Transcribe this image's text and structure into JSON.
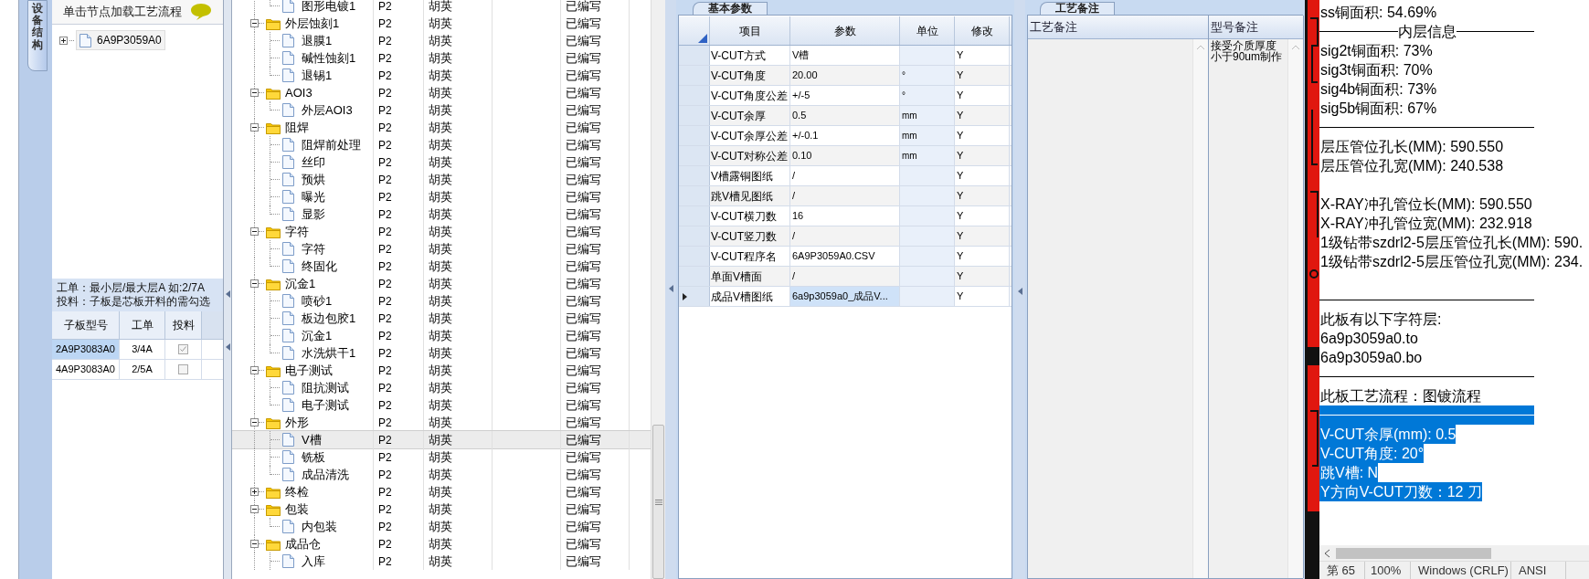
{
  "side_tab": {
    "label": "设备结构"
  },
  "process_panel": {
    "header": "单击节点加载工艺流程",
    "tree": [
      {
        "label": "6A9P3059A0",
        "expanded": false
      }
    ],
    "info": [
      "工单：最小层/最大层A 如:2/7A",
      "投料：子板是芯板开料的需勾选"
    ],
    "columns": [
      "子板型号",
      "工单",
      "投料"
    ],
    "rows": [
      {
        "model": "2A9P3083A0",
        "order": "3/4A",
        "checked": true,
        "selected": true
      },
      {
        "model": "4A9P3083A0",
        "order": "2/5A",
        "checked": false,
        "selected": false
      }
    ]
  },
  "flow_tree": {
    "groups": [
      {
        "children": [
          {
            "name": "图形电镀1",
            "code": "P2",
            "person": "胡英",
            "status": "已编写",
            "selected": false
          }
        ]
      },
      {
        "name": "外层蚀刻1",
        "code": "P2",
        "person": "胡英",
        "status": "已编写",
        "expanded": true,
        "selected": false,
        "children": [
          {
            "name": "退膜1",
            "code": "P2",
            "person": "胡英",
            "status": "已编写",
            "selected": false
          },
          {
            "name": "碱性蚀刻1",
            "code": "P2",
            "person": "胡英",
            "status": "已编写",
            "selected": false
          },
          {
            "name": "退锡1",
            "code": "P2",
            "person": "胡英",
            "status": "已编写",
            "selected": false
          }
        ]
      },
      {
        "name": "AOI3",
        "code": "P2",
        "person": "胡英",
        "status": "已编写",
        "expanded": true,
        "selected": false,
        "children": [
          {
            "name": "外层AOI3",
            "code": "P2",
            "person": "胡英",
            "status": "已编写",
            "selected": false
          }
        ]
      },
      {
        "name": "阻焊",
        "code": "P2",
        "person": "胡英",
        "status": "已编写",
        "expanded": true,
        "selected": false,
        "children": [
          {
            "name": "阻焊前处理",
            "code": "P2",
            "person": "胡英",
            "status": "已编写",
            "selected": false
          },
          {
            "name": "丝印",
            "code": "P2",
            "person": "胡英",
            "status": "已编写",
            "selected": false
          },
          {
            "name": "预烘",
            "code": "P2",
            "person": "胡英",
            "status": "已编写",
            "selected": false
          },
          {
            "name": "曝光",
            "code": "P2",
            "person": "胡英",
            "status": "已编写",
            "selected": false
          },
          {
            "name": "显影",
            "code": "P2",
            "person": "胡英",
            "status": "已编写",
            "selected": false
          }
        ]
      },
      {
        "name": "字符",
        "code": "P2",
        "person": "胡英",
        "status": "已编写",
        "expanded": true,
        "selected": false,
        "children": [
          {
            "name": "字符",
            "code": "P2",
            "person": "胡英",
            "status": "已编写",
            "selected": false
          },
          {
            "name": "终固化",
            "code": "P2",
            "person": "胡英",
            "status": "已编写",
            "selected": false
          }
        ]
      },
      {
        "name": "沉金1",
        "code": "P2",
        "person": "胡英",
        "status": "已编写",
        "expanded": true,
        "selected": false,
        "children": [
          {
            "name": "喷砂1",
            "code": "P2",
            "person": "胡英",
            "status": "已编写",
            "selected": false
          },
          {
            "name": "板边包胶1",
            "code": "P2",
            "person": "胡英",
            "status": "已编写",
            "selected": false
          },
          {
            "name": "沉金1",
            "code": "P2",
            "person": "胡英",
            "status": "已编写",
            "selected": false
          },
          {
            "name": "水洗烘干1",
            "code": "P2",
            "person": "胡英",
            "status": "已编写",
            "selected": false
          }
        ]
      },
      {
        "name": "电子测试",
        "code": "P2",
        "person": "胡英",
        "status": "已编写",
        "expanded": true,
        "selected": false,
        "children": [
          {
            "name": "阻抗测试",
            "code": "P2",
            "person": "胡英",
            "status": "已编写",
            "selected": false
          },
          {
            "name": "电子测试",
            "code": "P2",
            "person": "胡英",
            "status": "已编写",
            "selected": false
          }
        ]
      },
      {
        "name": "外形",
        "code": "P2",
        "person": "胡英",
        "status": "已编写",
        "expanded": true,
        "selected": false,
        "children": [
          {
            "name": "V槽",
            "code": "P2",
            "person": "胡英",
            "status": "已编写",
            "selected": true
          },
          {
            "name": "铣板",
            "code": "P2",
            "person": "胡英",
            "status": "已编写",
            "selected": false
          },
          {
            "name": "成品清洗",
            "code": "P2",
            "person": "胡英",
            "status": "已编写",
            "selected": false
          }
        ]
      },
      {
        "name": "终检",
        "code": "P2",
        "person": "胡英",
        "status": "已编写",
        "expanded": false,
        "selected": false
      },
      {
        "name": "包装",
        "code": "P2",
        "person": "胡英",
        "status": "已编写",
        "expanded": true,
        "selected": false,
        "children": [
          {
            "name": "内包装",
            "code": "P2",
            "person": "胡英",
            "status": "已编写",
            "selected": false
          }
        ]
      },
      {
        "name": "成品仓",
        "code": "P2",
        "person": "胡英",
        "status": "已编写",
        "expanded": true,
        "selected": false,
        "children": [
          {
            "name": "入库",
            "code": "P2",
            "person": "胡英",
            "status": "已编写",
            "selected": false
          }
        ]
      }
    ]
  },
  "params": {
    "tab": "基本参数",
    "columns": [
      "项目",
      "参数",
      "单位",
      "修改"
    ],
    "rows": [
      {
        "item": "V-CUT方式",
        "value": "V槽",
        "modify": "Y",
        "current": false
      },
      {
        "item": "V-CUT角度",
        "value": "20.00",
        "unit": "°",
        "modify": "Y",
        "current": false
      },
      {
        "item": "V-CUT角度公差",
        "value": "+/-5",
        "unit": "°",
        "modify": "Y",
        "current": false
      },
      {
        "item": "V-CUT余厚",
        "value": "0.5",
        "unit": "mm",
        "modify": "Y",
        "current": false
      },
      {
        "item": "V-CUT余厚公差",
        "value": "+/-0.1",
        "unit": "mm",
        "modify": "Y",
        "current": false
      },
      {
        "item": "V-CUT对称公差",
        "value": "0.10",
        "unit": "mm",
        "modify": "Y",
        "current": false
      },
      {
        "item": "V槽露铜图纸",
        "value": "/",
        "modify": "Y",
        "current": false
      },
      {
        "item": "跳V槽见图纸",
        "value": "/",
        "modify": "Y",
        "current": false
      },
      {
        "item": "V-CUT横刀数",
        "value": "16",
        "modify": "Y",
        "current": false
      },
      {
        "item": "V-CUT竖刀数",
        "value": "/",
        "modify": "Y",
        "current": false
      },
      {
        "item": "V-CUT程序名",
        "value": "6A9P3059A0.CSV",
        "modify": "Y",
        "current": false
      },
      {
        "item": "单面V槽面",
        "value": "/",
        "modify": "Y",
        "current": false
      },
      {
        "item": "成品V槽图纸",
        "value": "6a9p3059a0_成品V...",
        "modify": "Y",
        "current": true
      }
    ]
  },
  "notes": {
    "tab": "工艺备注",
    "columns": [
      "工艺备注",
      "型号备注"
    ],
    "model_note": [
      "接受介质厚度",
      "小于90um制作"
    ]
  },
  "editor": {
    "lines": [
      {
        "kind": "text",
        "text": "ss铜面积: 54.69%",
        "selected": false
      },
      {
        "kind": "titled_rule",
        "text": "内层信息",
        "selected": false
      },
      {
        "kind": "text",
        "text": "sig2t铜面积: 73%",
        "selected": false
      },
      {
        "kind": "text",
        "text": "sig3t铜面积: 70%",
        "selected": false
      },
      {
        "kind": "text",
        "text": "sig4b铜面积: 73%",
        "selected": false
      },
      {
        "kind": "text",
        "text": "sig5b铜面积: 67%",
        "selected": false
      },
      {
        "kind": "rule",
        "selected": false
      },
      {
        "kind": "text",
        "text": "层压管位孔长(MM): 590.550",
        "selected": false
      },
      {
        "kind": "text",
        "text": "层压管位孔宽(MM): 240.538",
        "selected": false
      },
      {
        "kind": "blank"
      },
      {
        "kind": "text",
        "text": "X-RAY冲孔管位长(MM): 590.550",
        "selected": false
      },
      {
        "kind": "text",
        "text": "X-RAY冲孔管位宽(MM): 232.918",
        "selected": false
      },
      {
        "kind": "text",
        "text": "1级钻带szdrl2-5层压管位孔长(MM): 590.",
        "selected": false
      },
      {
        "kind": "text",
        "text": "1级钻带szdrl2-5层压管位孔宽(MM): 234.",
        "selected": false
      },
      {
        "kind": "blank"
      },
      {
        "kind": "rule",
        "selected": false
      },
      {
        "kind": "text",
        "text": "此板有以下字符层:",
        "selected": false
      },
      {
        "kind": "text",
        "text": "6a9p3059a0.to",
        "selected": false
      },
      {
        "kind": "text",
        "text": "6a9p3059a0.bo",
        "selected": false
      },
      {
        "kind": "rule",
        "selected": false
      },
      {
        "kind": "text",
        "text": "此板工艺流程：图镀流程",
        "selected": false
      },
      {
        "kind": "rule",
        "selected": true
      },
      {
        "kind": "text",
        "text": "V-CUT余厚(mm): 0.5",
        "selected": true
      },
      {
        "kind": "text",
        "text": "V-CUT角度: 20°",
        "selected": true
      },
      {
        "kind": "text",
        "text": "跳V槽: N",
        "selected": true
      },
      {
        "kind": "text",
        "text": "Y方向V-CUT刀数：12 刀",
        "selected": true
      }
    ]
  },
  "status_bar": [
    "第 65",
    "100%",
    "Windows (CRLF)",
    "ANSI"
  ]
}
